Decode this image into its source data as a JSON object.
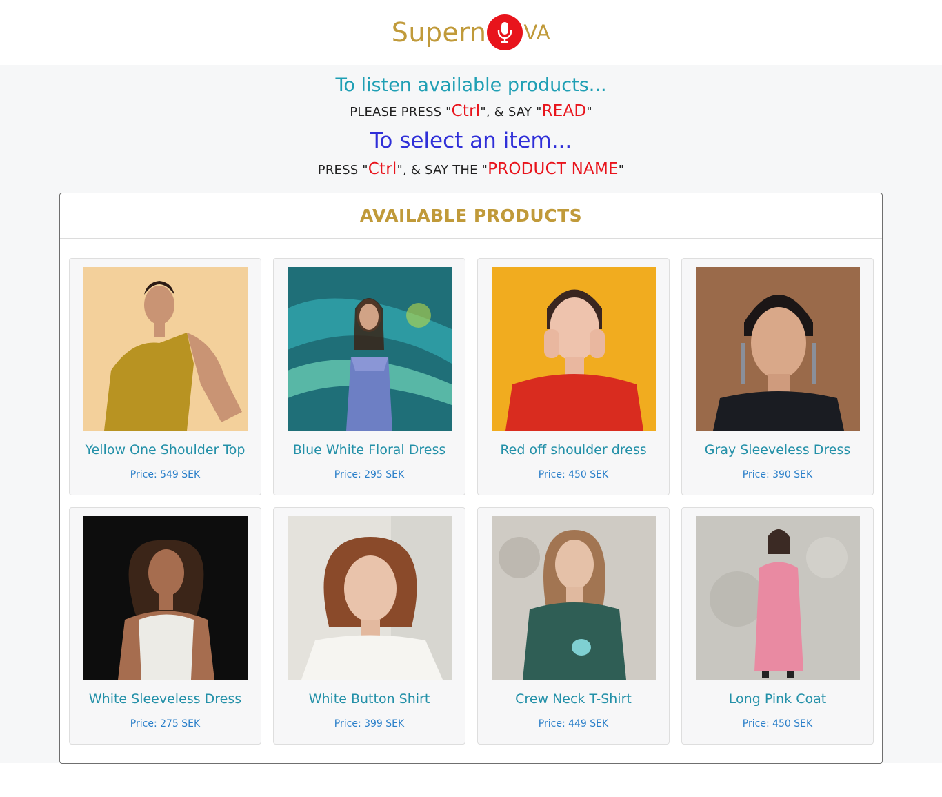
{
  "brand": {
    "part1": "Supern",
    "part2": "va",
    "mic_color": "#e8141c"
  },
  "instructions": {
    "listen_heading": "To listen available products...",
    "listen_prefix": "PLEASE PRESS \"",
    "key": "Ctrl",
    "listen_mid": "\", & SAY \"",
    "listen_word": "READ",
    "quote_end": "\"",
    "select_heading": "To select an item...",
    "select_prefix": "PRESS \"",
    "select_mid": "\", & SAY THE \"",
    "select_word": "PRODUCT NAME"
  },
  "products_panel": {
    "title": "AVAILABLE PRODUCTS",
    "items": [
      {
        "name": "Yellow One Shoulder Top",
        "price": "Price: 549 SEK"
      },
      {
        "name": "Blue White Floral Dress",
        "price": "Price: 295 SEK"
      },
      {
        "name": "Red off shoulder dress",
        "price": "Price: 450 SEK"
      },
      {
        "name": "Gray Sleeveless Dress",
        "price": "Price: 390 SEK"
      },
      {
        "name": "White Sleeveless Dress",
        "price": "Price: 275 SEK"
      },
      {
        "name": "White Button Shirt",
        "price": "Price: 399 SEK"
      },
      {
        "name": "Crew Neck T-Shirt",
        "price": "Price: 449 SEK"
      },
      {
        "name": "Long Pink Coat",
        "price": "Price: 450 SEK"
      }
    ]
  }
}
